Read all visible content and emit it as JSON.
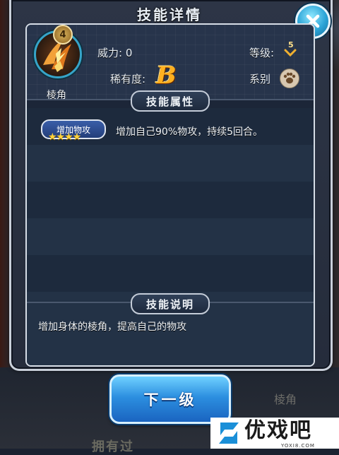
{
  "dialog": {
    "title": "技能详情",
    "close_icon": "close-icon"
  },
  "skill": {
    "name": "棱角",
    "level_badge": "4",
    "icon": "horn-claw-skill-icon",
    "power_label": "威力: 0",
    "grade_label": "等级:",
    "grade_value": "5",
    "rarity_label": "稀有度:",
    "rarity_value": "B",
    "series_label": "系别",
    "series_icon": "paw-icon"
  },
  "attributes": {
    "section_title": "技能属性",
    "tag": "增加物攻",
    "stars": "★★★★",
    "star_count": 4,
    "effect": "增加自己90%物攻，持续5回合。"
  },
  "description": {
    "section_title": "技能说明",
    "text": "增加身体的棱角，提高自己的物攻"
  },
  "actions": {
    "next_label": "下一级"
  },
  "background": {
    "bottom_label": "拥有过",
    "side_label": "棱角"
  },
  "watermark": {
    "text": "优戏吧",
    "sub": "YOXI8.COM"
  },
  "colors": {
    "accent_blue": "#2c8fe0",
    "rarity_orange": "#ffb020",
    "star_gold": "#ffd23a",
    "panel_border": "#c9d0da"
  }
}
